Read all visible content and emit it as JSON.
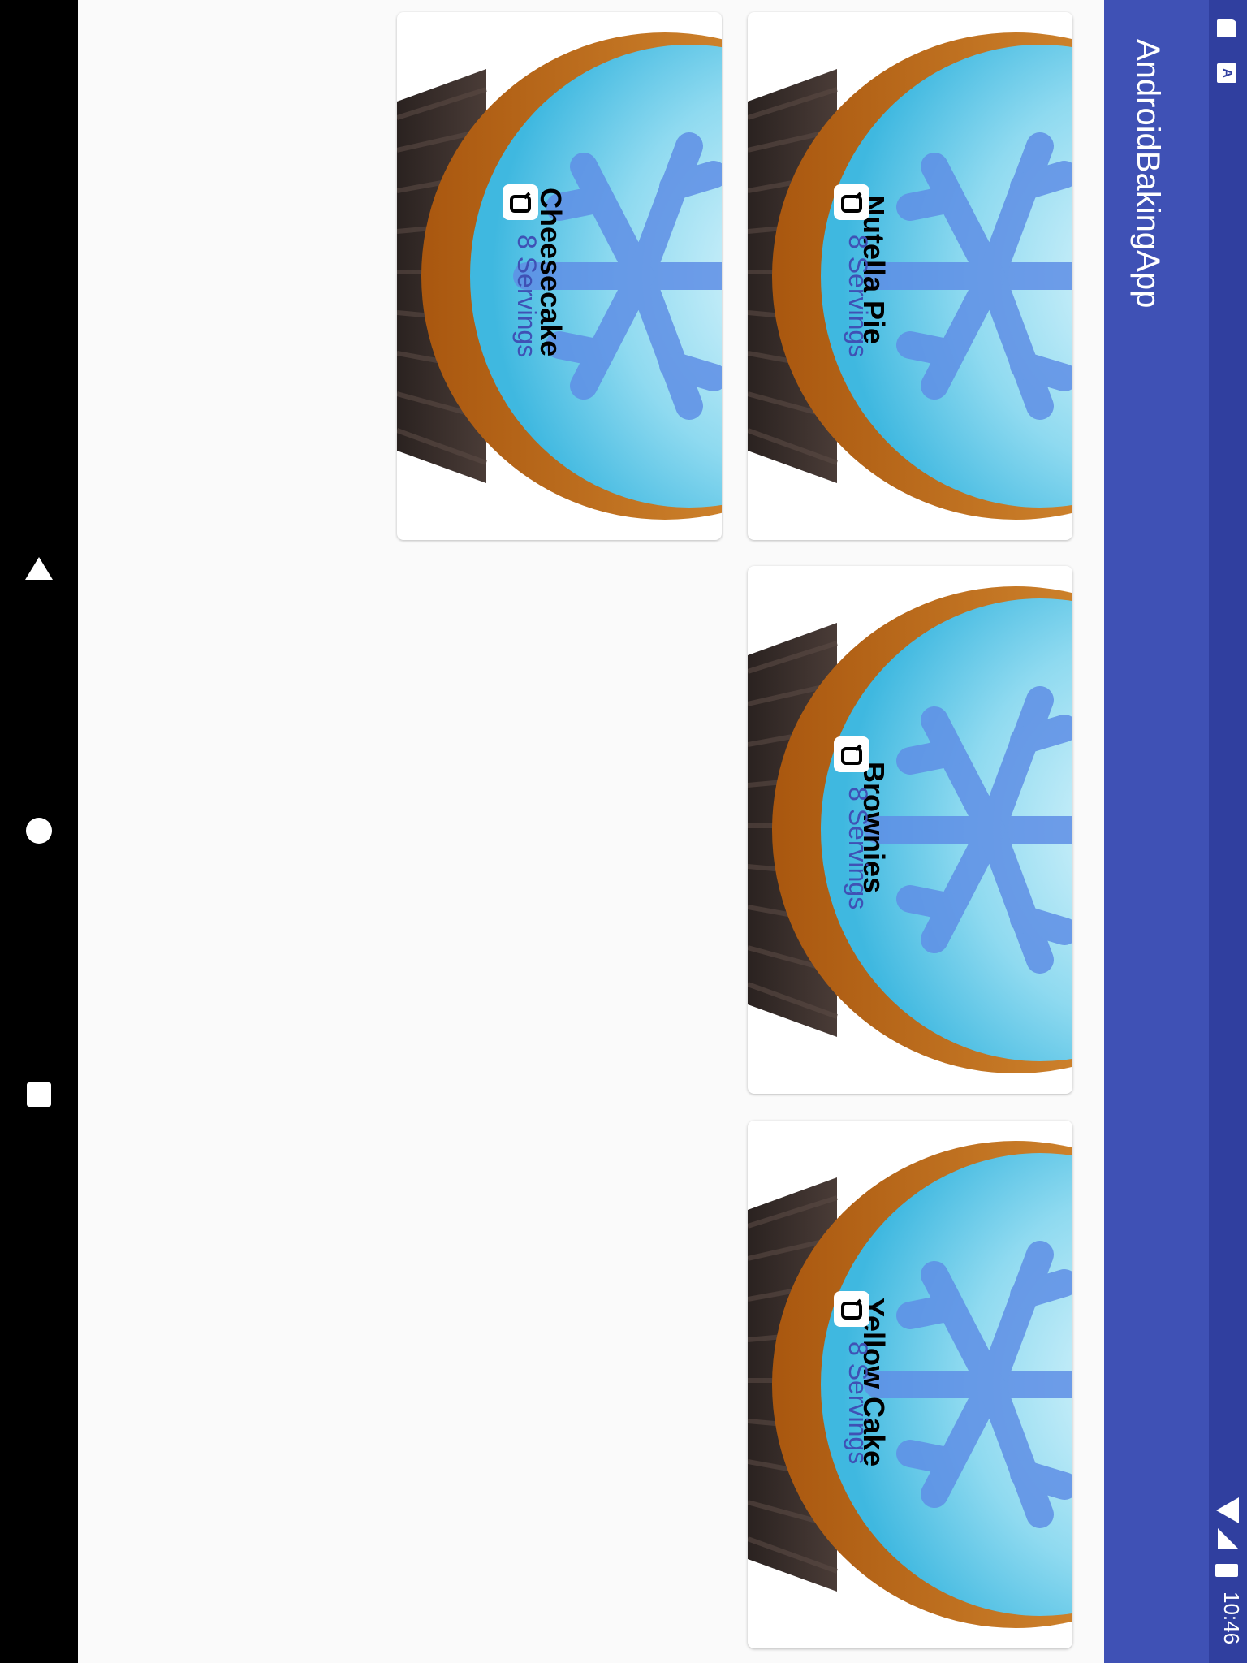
{
  "app": {
    "title": "AndroidBakingApp"
  },
  "status_bar": {
    "time": "10:46"
  },
  "recipes": [
    {
      "name": "Nutella Pie",
      "servings": "8",
      "servings_label": "Servings"
    },
    {
      "name": "Brownies",
      "servings": "8",
      "servings_label": "Servings"
    },
    {
      "name": "Yellow Cake",
      "servings": "8",
      "servings_label": "Servings"
    },
    {
      "name": "Cheesecake",
      "servings": "8",
      "servings_label": "Servings"
    }
  ],
  "icons": {
    "navigation": [
      "back-triangle-icon",
      "home-circle-icon",
      "recents-square-icon"
    ],
    "status": [
      "sd-card-icon",
      "notification-a-icon",
      "wifi-icon",
      "signal-icon",
      "battery-icon"
    ],
    "card": "serving-pot-icon"
  },
  "colors": {
    "app_bar": "#3f51b5",
    "status_bar": "#303f9f",
    "servings_text": "#3f51b5",
    "background": "#fafafa"
  }
}
